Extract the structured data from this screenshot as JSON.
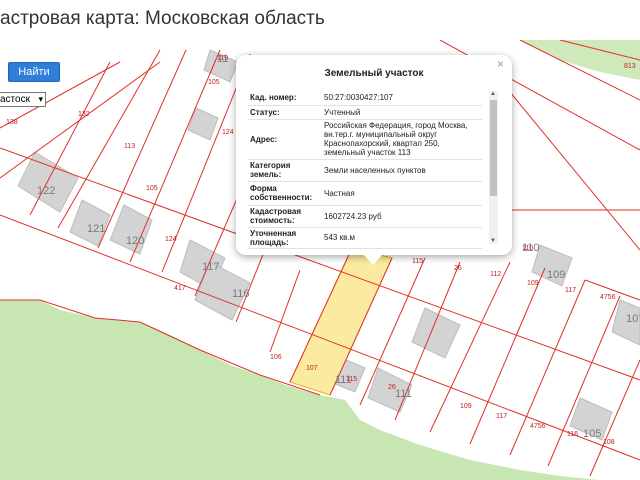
{
  "header": {
    "title": "астровая карта: Московская область"
  },
  "toolbar": {
    "search_label": "Найти",
    "layer_select_value": "астоск"
  },
  "popup": {
    "title": "Земельный участок",
    "close": "×",
    "rows": [
      {
        "label": "Кад. номер:",
        "value": "50:27:0030427:107"
      },
      {
        "label": "Статус:",
        "value": "Учтенный"
      },
      {
        "label": "Адрес:",
        "value": "Российская Федерация, город Москва, вн.тер.г. муниципальный округ Краснопахорский, квартал 250, земельный участок 113"
      },
      {
        "label": "Категория земель:",
        "value": "Земли населенных пунктов"
      },
      {
        "label": "Форма собственности:",
        "value": "Частная"
      },
      {
        "label": "Кадастровая стоимость:",
        "value": "1602724.23 руб"
      },
      {
        "label": "Уточненная площадь:",
        "value": "543 кв.м"
      }
    ]
  },
  "map": {
    "parcel_labels": [
      "138",
      "132",
      "105",
      "119",
      "113",
      "124",
      "105",
      "124",
      "417",
      "117",
      "106",
      "107",
      "115",
      "26",
      "112",
      "117",
      "109",
      "109",
      "4756",
      "108",
      "110",
      "117",
      "4756",
      "116",
      "108",
      "813",
      "107",
      "26"
    ],
    "building_labels": [
      "122",
      "121",
      "120",
      "117",
      "116",
      "111",
      "115",
      "111",
      "110",
      "109",
      "105",
      "107",
      "11"
    ],
    "colors": {
      "background": "#ffffff",
      "green_area": "#c8e6b2",
      "parcel_line": "#e0302a",
      "building": "#d4d4d4",
      "selected_parcel": "#fbeba0",
      "label": "#c0221e"
    }
  }
}
